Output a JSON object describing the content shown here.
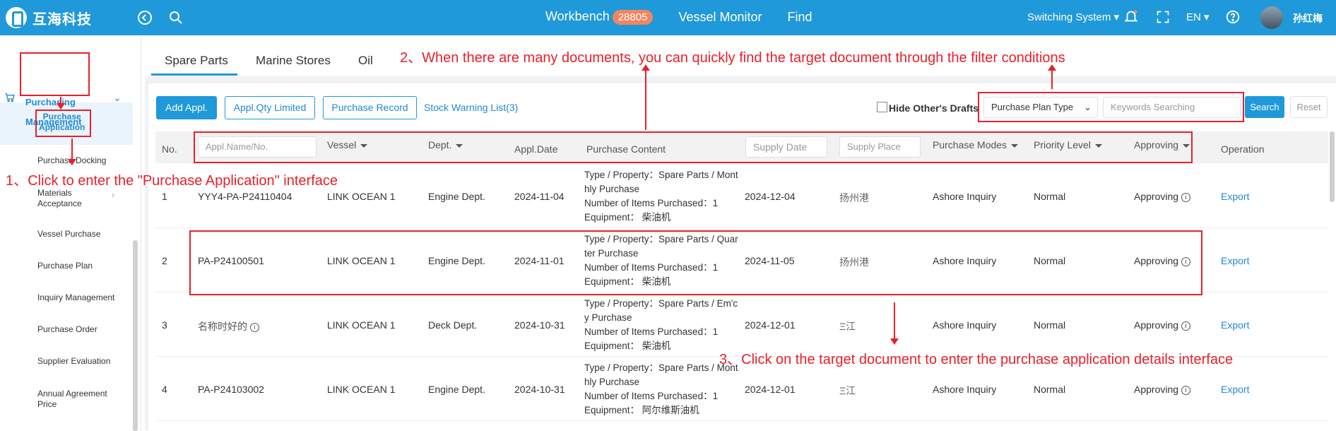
{
  "app": {
    "logo_text": "互海科技"
  },
  "topnav": {
    "workbench": "Workbench",
    "workbench_badge": "28805",
    "vessel_monitor": "Vessel Monitor",
    "find": "Find",
    "switching_system": "Switching System",
    "language": "EN",
    "user_name": "孙红梅"
  },
  "sidebar": {
    "purchasing_management_line1": "Purchasing",
    "purchasing_management_line2": "Management",
    "active_line1": "Purchase",
    "active_line2": "Application",
    "items": [
      "Purchase Docking",
      "Materials",
      "Acceptance",
      "Vessel Purchase",
      "Purchase Plan",
      "Inquiry Management",
      "Purchase Order",
      "Supplier Evaluation",
      "Annual Agreement",
      "Price"
    ]
  },
  "tabs": [
    "Spare Parts",
    "Marine Stores",
    "Oil"
  ],
  "toolbar": {
    "add_appl": "Add Appl.",
    "appl_qty_limited": "Appl.Qty Limited",
    "purchase_record": "Purchase Record",
    "stock_warning": "Stock Warning List(3)",
    "hide_drafts": "Hide Other's Drafts",
    "plan_type": "Purchase Plan Type",
    "keywords_placeholder": "Keywords Searching",
    "search": "Search",
    "reset": "Reset"
  },
  "table": {
    "headers": {
      "no": "No.",
      "appl_name_placeholder": "Appl.Name/No.",
      "vessel": "Vessel",
      "dept": "Dept.",
      "appl_date": "Appl.Date",
      "purchase_content": "Purchase Content",
      "supply_date_placeholder": "Supply Date",
      "supply_place_placeholder": "Supply Place",
      "purchase_modes": "Purchase Modes",
      "priority_level": "Priority Level",
      "approving": "Approving",
      "operation": "Operation"
    },
    "rows": [
      {
        "no": "1",
        "name": "YYY4-PA-P24110404",
        "vessel": "LINK OCEAN 1",
        "dept": "Engine Dept.",
        "date": "2024-11-04",
        "c1": "Type / Property：Spare Parts / Monthly Purchase",
        "c2": "Number of Items Purchased：1",
        "c3": "Equipment： 柴油机",
        "supply_date": "2024-12-04",
        "supply_place": "扬州港",
        "mode": "Ashore Inquiry",
        "priority": "Normal",
        "status": "Approving",
        "op": "Export"
      },
      {
        "no": "2",
        "name": "PA-P24100501",
        "vessel": "LINK OCEAN 1",
        "dept": "Engine Dept.",
        "date": "2024-11-01",
        "c1": "Type / Property：Spare Parts / Quarter Purchase",
        "c2": "Number of Items Purchased：1",
        "c3": "Equipment： 柴油机",
        "supply_date": "2024-11-05",
        "supply_place": "扬州港",
        "mode": "Ashore Inquiry",
        "priority": "Normal",
        "status": "Approving",
        "op": "Export"
      },
      {
        "no": "3",
        "name": "名称时好的",
        "vessel": "LINK OCEAN 1",
        "dept": "Deck Dept.",
        "date": "2024-10-31",
        "c1": "Type / Property：Spare Parts / Em'cy Purchase",
        "c2": "Number of Items Purchased：1",
        "c3": "Equipment： 柴油机",
        "supply_date": "2024-12-01",
        "supply_place": "Ξ江",
        "mode": "Ashore Inquiry",
        "priority": "Normal",
        "status": "Approving",
        "op": "Export"
      },
      {
        "no": "4",
        "name": "PA-P24103002",
        "vessel": "LINK OCEAN 1",
        "dept": "Engine Dept.",
        "date": "2024-10-31",
        "c1": "Type / Property：Spare Parts / Monthly Purchase",
        "c2": "Number of Items Purchased：1",
        "c3": "Equipment： 阿尔维斯油机",
        "supply_date": "2024-12-01",
        "supply_place": "Ξ江",
        "mode": "Ashore Inquiry",
        "priority": "Normal",
        "status": "Approving",
        "op": "Export"
      }
    ]
  },
  "annotations": {
    "a1": "1、Click to enter the \"Purchase Application\" interface",
    "a2": "2、When there are many documents, you can quickly find the target document through the filter conditions",
    "a3": "3、Click on the target document to enter the purchase application details interface"
  },
  "colors": {
    "accent": "#1f99d9",
    "annotation": "#e8202a"
  }
}
